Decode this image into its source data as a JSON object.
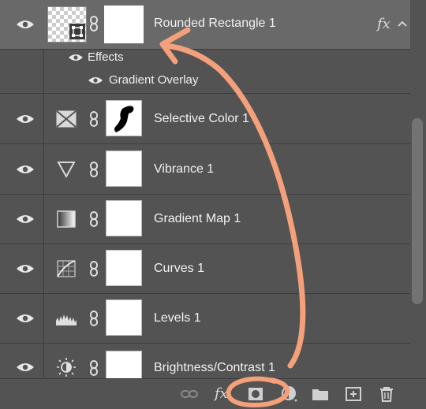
{
  "layers": [
    {
      "name": "Rounded Rectangle 1",
      "selected": true,
      "thumb": "rounded-rect-thumbnail",
      "fx": "fx",
      "effects_label": "Effects",
      "effect_item": "Gradient Overlay"
    },
    {
      "name": "Selective Color 1",
      "adj_icon": "selective-color-icon"
    },
    {
      "name": "Vibrance 1",
      "adj_icon": "vibrance-icon"
    },
    {
      "name": "Gradient Map 1",
      "adj_icon": "gradient-map-icon"
    },
    {
      "name": "Curves 1",
      "adj_icon": "curves-icon"
    },
    {
      "name": "Levels 1",
      "adj_icon": "levels-icon"
    },
    {
      "name": "Brightness/Contrast 1",
      "adj_icon": "brightness-contrast-icon"
    }
  ],
  "bottombar": {
    "icons": [
      "link-layers-icon",
      "add-layer-style-icon",
      "add-mask-icon",
      "new-adjustment-layer-icon",
      "new-group-icon",
      "new-layer-icon",
      "delete-layer-icon"
    ],
    "fx_label": "fx"
  },
  "colors": {
    "panel_bg": "#535353",
    "selected_row": "#696969",
    "annotation": "#f4a07a"
  }
}
